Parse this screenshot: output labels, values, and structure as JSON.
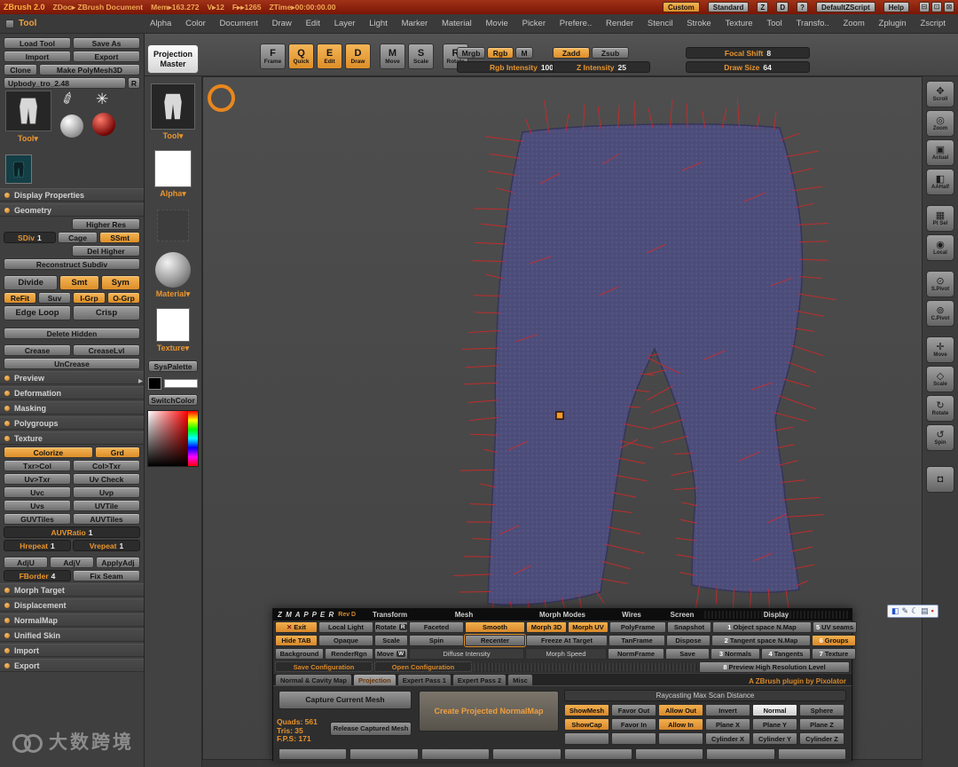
{
  "colors": {
    "accent_orange": "#e8952f",
    "titlebar_red": "#8c1d0d",
    "canvas_gray": "#474747",
    "model_purple": "#4d4d7a",
    "spike_red": "#c62b2b"
  },
  "icons": {
    "scroll": "✥",
    "zoom": "◎",
    "actual": "▣",
    "aahalf": "◧",
    "ptsel": "▦",
    "local": "◉",
    "spivot": "⊙",
    "cpivot": "⊚",
    "move": "✛",
    "scale": "◇",
    "rotate": "↻",
    "spin": "↺",
    "camera": "◘",
    "minimize": "⊟",
    "restore": "⊡",
    "close": "⊠",
    "exit_x": "✕",
    "brush": "✐",
    "star": "✳",
    "ime_lang": "◧",
    "ime_pen": "✎",
    "ime_moon": "☾",
    "ime_keyboard": "▤",
    "ime_dot": "▪",
    "tray_arrow": "▸"
  },
  "titlebar": {
    "app": "ZBrush 2.0",
    "doc": "ZDoc▸ ZBrush Document",
    "stats": [
      "Mem▸163.272",
      "V▸12",
      "F▸▸1265",
      "ZTime▸00:00:00.00"
    ],
    "right": {
      "custom": "Custom",
      "standard": "Standard",
      "z": "Z",
      "d": "D",
      "question": "?",
      "zscript": "DefaultZScript",
      "help": "Help"
    }
  },
  "menubar": {
    "palette_header": "Tool",
    "items": [
      "Alpha",
      "Color",
      "Document",
      "Draw",
      "Edit",
      "Layer",
      "Light",
      "Marker",
      "Material",
      "Movie",
      "Picker",
      "Prefere..",
      "Render",
      "Stencil",
      "Stroke",
      "Texture",
      "Tool",
      "Transfo..",
      "Zoom",
      "Zplugin",
      "Zscript"
    ]
  },
  "shelf": {
    "projection_master": "Projection Master",
    "modes": [
      {
        "icon": "F",
        "label": "Frame"
      },
      {
        "icon": "Q",
        "label": "Quick"
      },
      {
        "icon": "E",
        "label": "Edit"
      },
      {
        "icon": "D",
        "label": "Draw"
      },
      {
        "icon": "M",
        "label": "Move"
      },
      {
        "icon": "S",
        "label": "Scale"
      },
      {
        "icon": "R",
        "label": "Rotate"
      }
    ],
    "mrgb": "Mrgb",
    "rgb": "Rgb",
    "m": "M",
    "zadd": "Zadd",
    "zsub": "Zsub",
    "rgb_intensity_label": "Rgb Intensity",
    "rgb_intensity_value": "100",
    "z_intensity_label": "Z Intensity",
    "z_intensity_value": "25",
    "focal_shift_label": "Focal Shift",
    "focal_shift_value": "8",
    "draw_size_label": "Draw Size",
    "draw_size_value": "64"
  },
  "tool_palette": {
    "load_tool": "Load Tool",
    "save_as": "Save As",
    "import": "Import",
    "export": "Export",
    "clone": "Clone",
    "make_polymesh": "Make PolyMesh3D",
    "tool_name": "Upbody_tro_2.48",
    "r": "R",
    "tool_dropdown": "Tool▾",
    "display_properties": "Display Properties",
    "geometry": "Geometry",
    "higher_res": "Higher Res",
    "sdiv_label": "SDiv",
    "sdiv_value": "1",
    "cage": "Cage",
    "ssmt": "SSmt",
    "del_higher": "Del Higher",
    "reconstruct": "Reconstruct Subdiv",
    "divide": "Divide",
    "smt": "Smt",
    "sym": "Sym",
    "refit": "ReFit",
    "suv": "Suv",
    "igrp": "I-Grp",
    "ogrp": "O-Grp",
    "edge_loop": "Edge Loop",
    "crisp": "Crisp",
    "delete_hidden": "Delete Hidden",
    "crease": "Crease",
    "crease_lvl": "CreaseLvl",
    "uncrease": "UnCrease",
    "preview": "Preview",
    "deformation": "Deformation",
    "masking": "Masking",
    "polygroups": "Polygroups",
    "texture": "Texture",
    "colorize": "Colorize",
    "grd": "Grd",
    "txr_col": "Txr>Col",
    "col_txr": "Col>Txr",
    "uv_txr": "Uv>Txr",
    "uv_check": "Uv Check",
    "uvc": "Uvc",
    "uvp": "Uvp",
    "uvs": "Uvs",
    "uvtile": "UVTile",
    "guvtiles": "GUVTiles",
    "auvtiles": "AUVTiles",
    "auvratio_label": "AUVRatio",
    "auvratio_value": "1",
    "hrepeat_label": "Hrepeat",
    "hrepeat_value": "1",
    "vrepeat_label": "Vrepeat",
    "vrepeat_value": "1",
    "adju": "AdjU",
    "adjv": "AdjV",
    "applyadj": "ApplyAdj",
    "fborder_label": "FBorder",
    "fborder_value": "4",
    "fix_seam": "Fix Seam",
    "morph_target": "Morph Target",
    "displacement": "Displacement",
    "normalmap": "NormalMap",
    "unified_skin": "Unified Skin",
    "import_section": "Import",
    "export_section": "Export"
  },
  "tray": {
    "tool_label": "Tool▾",
    "alpha_label": "Alpha▾",
    "material_label": "Material▾",
    "texture_label": "Texture▾",
    "syspalette": "SysPalette",
    "switchcolor": "SwitchColor"
  },
  "right_shelf": {
    "labels": [
      "Scroll",
      "Zoom",
      "Actual",
      "AAHalf",
      "Pt Sel",
      "Local",
      "S.Pivot",
      "C.Pivot",
      "Move",
      "Scale",
      "Rotate",
      "Spin"
    ]
  },
  "zmapper": {
    "title": "Z M A P P E R",
    "rev": "Rev D",
    "headers": [
      "Transform",
      "Mesh",
      "Morph Modes",
      "Wires",
      "Screen",
      "Display"
    ],
    "exit": "Exit",
    "local_light": "Local Light",
    "rotate": "Rotate",
    "rotate_key": "R",
    "faceted": "Faceted",
    "smooth": "Smooth",
    "morph3d": "Morph 3D",
    "morphuv": "Morph UV",
    "polyframe": "PolyFrame",
    "snapshot": "Snapshot",
    "n1": "1",
    "n1_label": "Object space N.Map",
    "n5": "5",
    "n5_label": "UV seams",
    "hide_tab": "Hide TAB",
    "opaque": "Opaque",
    "scale": "Scale",
    "spin": "Spin",
    "recenter": "Recenter",
    "freeze": "Freeze At Target",
    "tanframe": "TanFrame",
    "dispose": "Dispose",
    "n2": "2",
    "n2_label": "Tangent space N.Map",
    "n6": "6",
    "n6_label": "Groups",
    "background": "Background",
    "renderrgn": "RenderRgn",
    "move": "Move",
    "move_key": "W",
    "diffuse": "Diffuse Intensity",
    "morph_speed": "Morph Speed",
    "normframe": "NormFrame",
    "save": "Save",
    "n3": "3",
    "n3_label": "Normals",
    "n4": "4",
    "n4_label": "Tangents",
    "n7": "7",
    "n7_label": "Texture",
    "save_config": "Save Configuration",
    "open_config": "Open Configuration",
    "n8": "8",
    "preview_label": "Preview High Resolution Level",
    "tabs": [
      "Normal & Cavity Map",
      "Projection",
      "Expert Pass 1",
      "Expert Pass 2",
      "Misc"
    ],
    "credit": "A ZBrush plugin by Pixolator",
    "raycasting": "Raycasting Max Scan Distance",
    "capture": "Capture Current Mesh",
    "release": "Release Captured Mesh",
    "create": "Create Projected NormalMap",
    "stats": [
      "Quads: 561",
      "Tris: 35",
      "F.P.S: 171"
    ],
    "showmesh": "ShowMesh",
    "favor_out": "Favor Out",
    "allow_out": "Allow Out",
    "invert": "Invert",
    "normal": "Normal",
    "sphere": "Sphere",
    "showcap": "ShowCap",
    "favor_in": "Favor In",
    "allow_in": "Allow In",
    "plane_x": "Plane X",
    "plane_y": "Plane Y",
    "plane_z": "Plane Z",
    "cylinder_x": "Cylinder X",
    "cylinder_y": "Cylinder Y",
    "cylinder_z": "Cylinder Z"
  },
  "watermark": {
    "text": "大数跨境"
  }
}
